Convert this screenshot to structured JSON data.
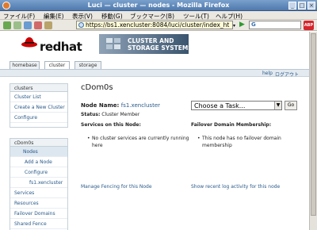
{
  "window": {
    "title": "Luci — cluster — nodes - Mozilla Firefox"
  },
  "menubar": {
    "items": [
      "ファイル(F)",
      "編集(E)",
      "表示(V)",
      "移動(G)",
      "ブックマーク(B)",
      "ツール(T)",
      "ヘルプ(H)"
    ]
  },
  "navbar": {
    "url": "https://bs1.xencluster:8084/luci/cluster/index_ht",
    "search_logo": "G"
  },
  "header": {
    "logo_text": "redhat",
    "banner_line1": "CLUSTER AND",
    "banner_line2": "STORAGE SYSTEMS"
  },
  "tabs": [
    {
      "label": "homebase"
    },
    {
      "label": "cluster"
    },
    {
      "label": "storage"
    }
  ],
  "utility": {
    "help": "help",
    "logout": "ログアウト"
  },
  "sidebar_clusters": {
    "header": "clusters",
    "items": [
      "Cluster List",
      "Create a New Cluster",
      "Configure"
    ]
  },
  "sidebar_cluster": {
    "header": "cDom0s",
    "items": [
      "Nodes",
      "Add a Node",
      "Configure",
      "fs1.xencluster",
      "Services",
      "Resources",
      "Failover Domains",
      "Shared Fence"
    ]
  },
  "main": {
    "title": "cDom0s",
    "node_label": "Node Name:",
    "node_name": "fs1.xencluster",
    "status_label": "Status:",
    "status_value": "Cluster Member",
    "task_placeholder": "Choose a Task...",
    "go_label": "Go",
    "services_header": "Services on this Node:",
    "services_text": "No cluster services are currently running here",
    "failover_header": "Failover Domain Membership:",
    "failover_text_1": "This node has no failover domain",
    "failover_text_2": "membership",
    "manage_fencing": "Manage Fencing for this Node",
    "show_log": "Show recent log activity for this node"
  },
  "colors": {
    "link": "#2a5a8a",
    "titlebar": "#4f79ad",
    "redhat_red": "#cc0000"
  }
}
